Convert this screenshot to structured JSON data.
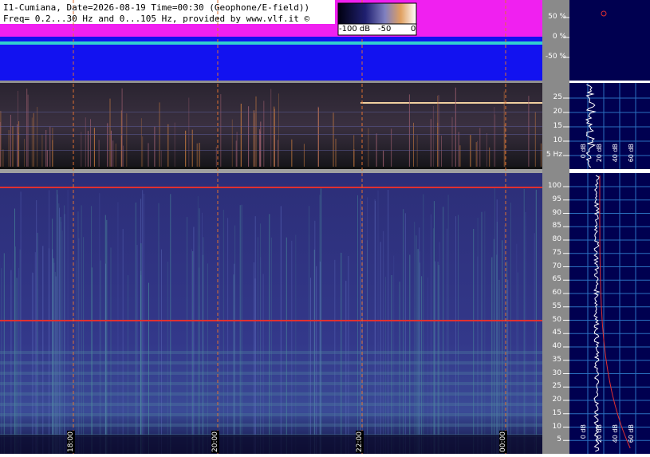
{
  "header": {
    "line1": "I1-Cumiana, Date=2026-08-19 Time=00:30 (Geophone/E-field))",
    "line2": "Freq= 0.2...30 Hz and 0...105 Hz, provided by www.vlf.it ©"
  },
  "colorbar": {
    "labels": [
      "-100 dB",
      "-50",
      "0"
    ]
  },
  "percent_axis": {
    "labels": [
      "50 %",
      "0 %",
      "-50 %"
    ]
  },
  "mid_axis": {
    "labels": [
      "25",
      "20",
      "15",
      "10",
      "5 Hz"
    ]
  },
  "main_axis": {
    "labels": [
      "100",
      "95",
      "90",
      "85",
      "80",
      "75",
      "70",
      "65",
      "60",
      "55",
      "50",
      "45",
      "40",
      "35",
      "30",
      "25",
      "20",
      "15",
      "10",
      "5"
    ]
  },
  "time_labels": [
    "18:00",
    "20:00",
    "22:00",
    "00:00"
  ],
  "mid_db_labels": [
    "0 dB",
    "20 dB",
    "40 dB",
    "60 dB"
  ],
  "bottom_db_labels": [
    "0 dB",
    "20 dB",
    "40 dB",
    "60 dB"
  ],
  "colors": {
    "spectrogram_bg": "#2b2f7a",
    "top_panel_blue": "#1212f0",
    "magenta": "#f020f0",
    "cursor_line": "#e07030",
    "hum_line": "#e03030",
    "side_bg": "#000050",
    "axis_bg": "#8a8a8a"
  }
}
